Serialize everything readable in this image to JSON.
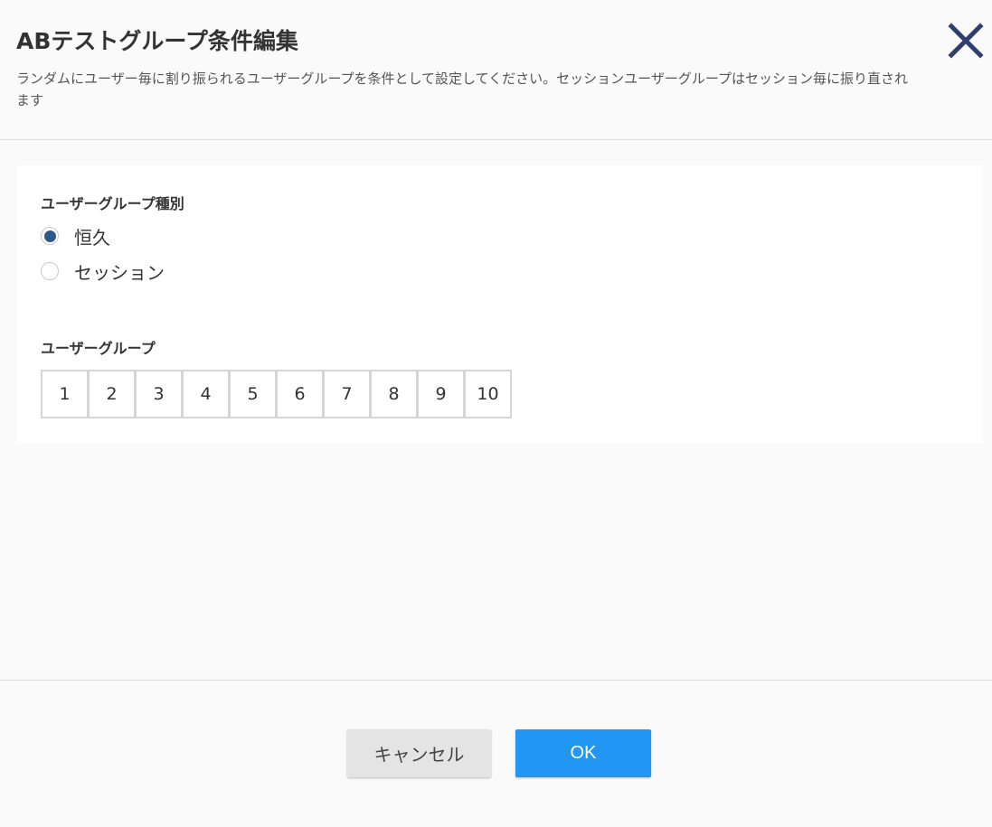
{
  "header": {
    "title": "ABテストグループ条件編集",
    "description": "ランダムにユーザー毎に割り振られるユーザーグループを条件として設定してください。セッションユーザーグループはセッション毎に振り直されます"
  },
  "close_icon": "close-icon",
  "user_group_type": {
    "label": "ユーザーグループ種別",
    "options": [
      {
        "label": "恒久",
        "checked": true
      },
      {
        "label": "セッション",
        "checked": false
      }
    ]
  },
  "user_group": {
    "label": "ユーザーグループ",
    "buttons": [
      "1",
      "2",
      "3",
      "4",
      "5",
      "6",
      "7",
      "8",
      "9",
      "10"
    ]
  },
  "footer": {
    "cancel_label": "キャンセル",
    "ok_label": "OK"
  },
  "colors": {
    "accent": "#2196f3",
    "radio_selected": "#2c5b8b",
    "close_icon": "#2e3f6e"
  }
}
